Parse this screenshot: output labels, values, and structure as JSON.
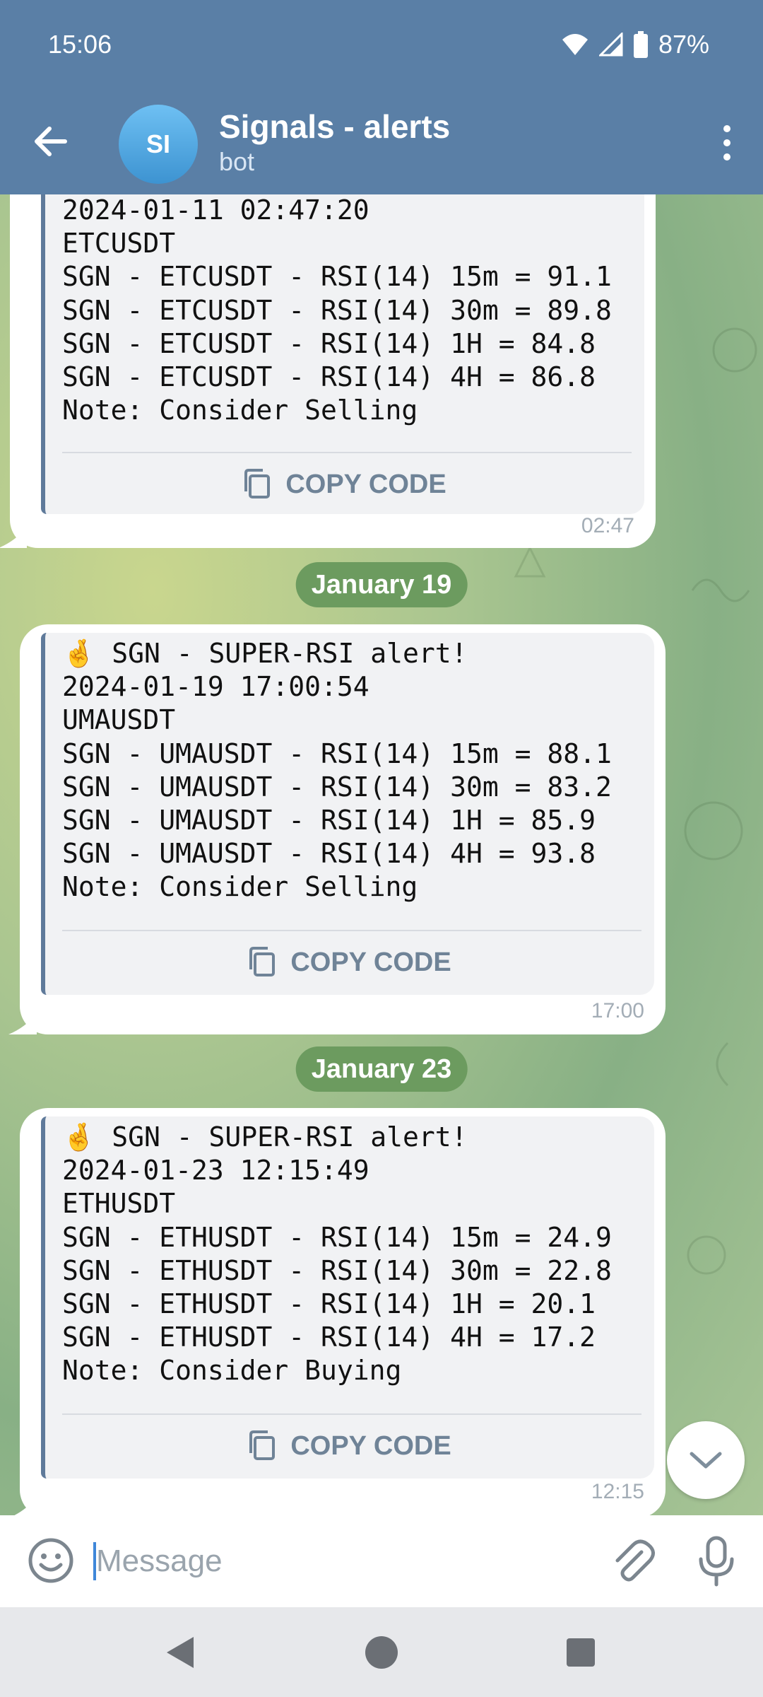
{
  "status_bar": {
    "time": "15:06",
    "battery": "87%",
    "icons": [
      "wifi-icon",
      "signal-icon",
      "battery-icon"
    ]
  },
  "app_bar": {
    "avatar_initials": "SI",
    "title": "Signals - alerts",
    "subtitle": "bot",
    "icons": [
      "back-arrow-icon",
      "more-vert-icon"
    ]
  },
  "messages": [
    {
      "lines": "2024-01-11 02:47:20\nETCUSDT\nSGN - ETCUSDT - RSI(14) 15m = 91.1\nSGN - ETCUSDT - RSI(14) 30m = 89.8\nSGN - ETCUSDT - RSI(14) 1H = 84.8\nSGN - ETCUSDT - RSI(14) 4H = 86.8\nNote: Consider Selling",
      "copy_label": "COPY CODE",
      "time": "02:47"
    },
    {
      "date_separator": "January 19",
      "lines": "🤞 SGN - SUPER-RSI alert!\n2024-01-19 17:00:54\nUMAUSDT\nSGN - UMAUSDT - RSI(14) 15m = 88.1\nSGN - UMAUSDT - RSI(14) 30m = 83.2\nSGN - UMAUSDT - RSI(14) 1H = 85.9\nSGN - UMAUSDT - RSI(14) 4H = 93.8\nNote: Consider Selling",
      "copy_label": "COPY CODE",
      "time": "17:00"
    },
    {
      "date_separator": "January 23",
      "lines": "🤞 SGN - SUPER-RSI alert!\n2024-01-23 12:15:49\nETHUSDT\nSGN - ETHUSDT - RSI(14) 15m = 24.9\nSGN - ETHUSDT - RSI(14) 30m = 22.8\nSGN - ETHUSDT - RSI(14) 1H = 20.1\nSGN - ETHUSDT - RSI(14) 4H = 17.2\nNote: Consider Buying",
      "copy_label": "COPY CODE",
      "time": "12:15"
    }
  ],
  "input": {
    "placeholder": "Message",
    "icons": [
      "emoji-icon",
      "attach-icon",
      "mic-icon"
    ]
  },
  "nav": {
    "icons": [
      "nav-back-icon",
      "nav-home-icon",
      "nav-recents-icon"
    ]
  },
  "colors": {
    "header": "#5a7fa6",
    "code_accent": "#5f7a9a",
    "date_chip": "#6c9b5f",
    "copy_label": "#6f8397"
  }
}
